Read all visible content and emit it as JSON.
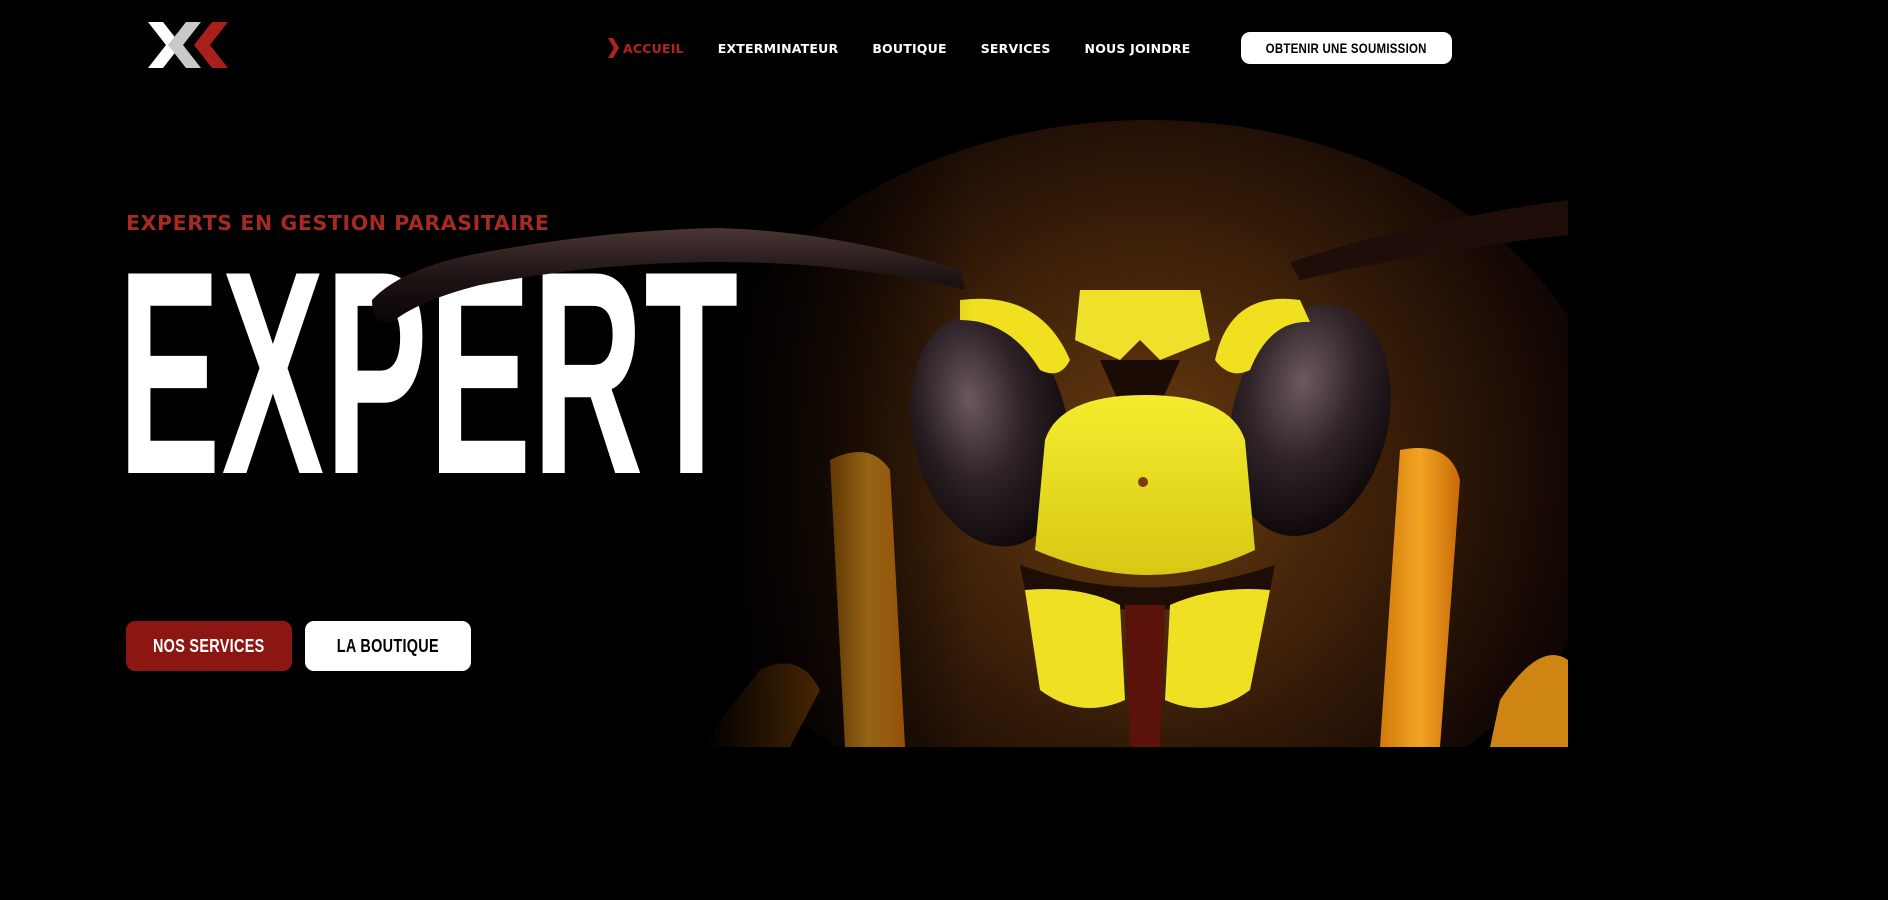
{
  "header": {
    "logo_alt": "Logo",
    "nav": [
      {
        "label": "ACCUEIL",
        "active": true
      },
      {
        "label": "EXTERMINATEUR",
        "active": false
      },
      {
        "label": "BOUTIQUE",
        "active": false
      },
      {
        "label": "SERVICES",
        "active": false
      },
      {
        "label": "NOUS JOINDRE",
        "active": false
      }
    ],
    "cta_label": "OBTENIR UNE SOUMISSION"
  },
  "hero": {
    "tagline": "EXPERTS EN GESTION PARASITAIRE",
    "headline": "EXPERT",
    "primary_button": "NOS SERVICES",
    "secondary_button": "LA BOUTIQUE"
  },
  "colors": {
    "background": "#000000",
    "accent_red": "#a52a21",
    "button_red": "#8c1611",
    "white": "#ffffff",
    "wasp_yellow": "#f2e21a"
  },
  "icons": {
    "active_indicator": "chevron-right-icon",
    "logo": "x-logo-icon"
  }
}
